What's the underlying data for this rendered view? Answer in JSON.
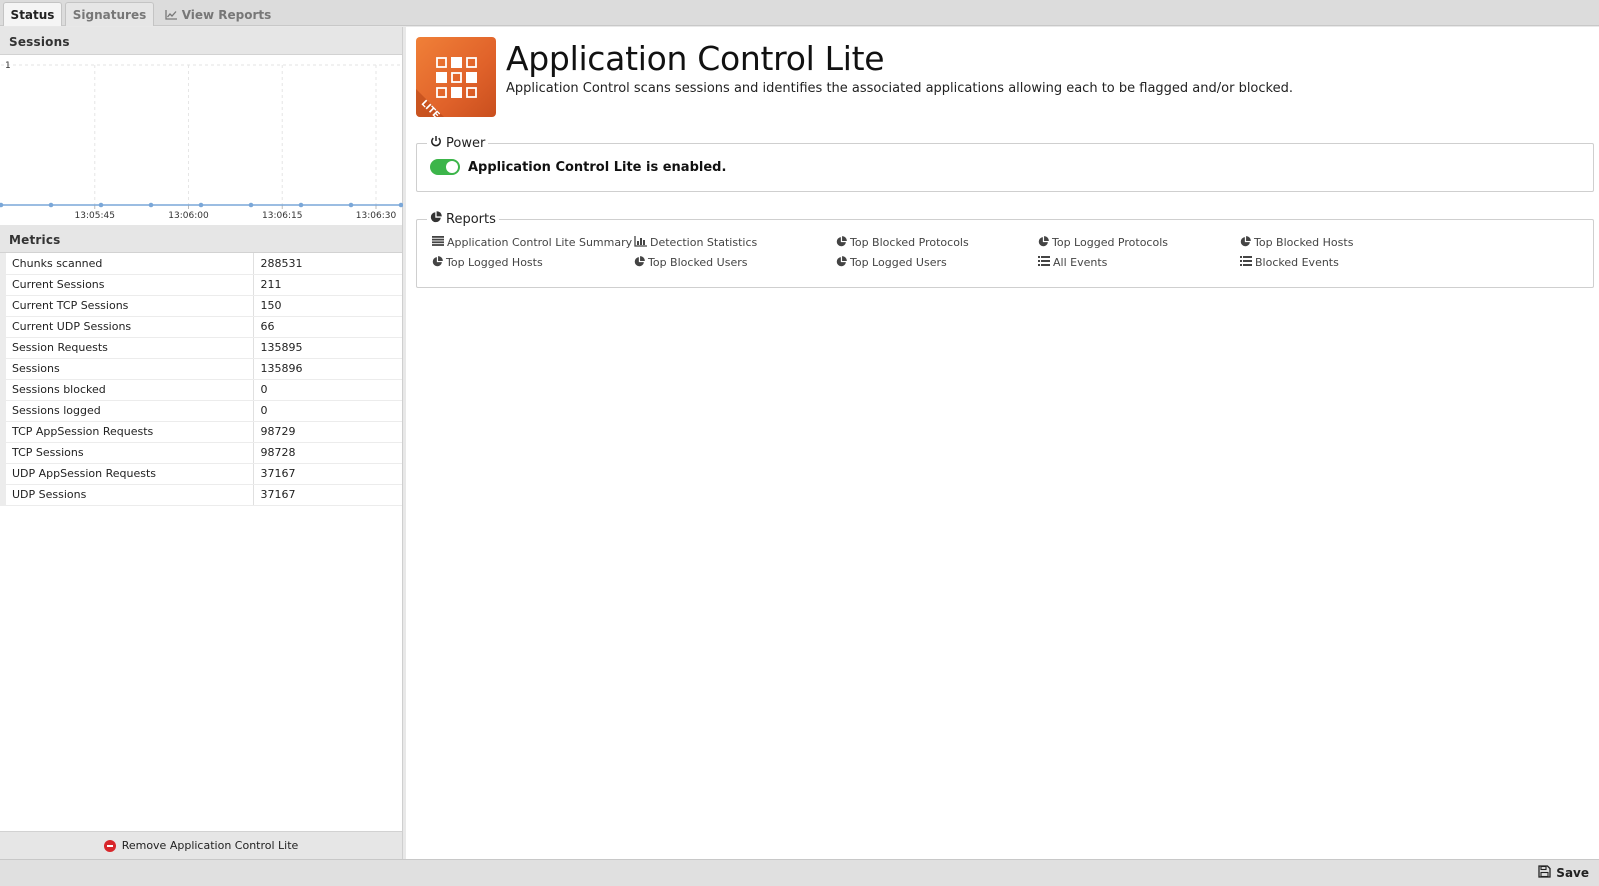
{
  "tabs": [
    {
      "label": "Status",
      "active": true
    },
    {
      "label": "Signatures",
      "active": false
    },
    {
      "label": "View Reports",
      "active": false,
      "icon": "line-chart-icon"
    }
  ],
  "sessions_panel": {
    "title": "Sessions",
    "chart_data": {
      "type": "line",
      "title": "",
      "x": [
        "13:05:30",
        "13:05:38",
        "13:05:46",
        "13:05:54",
        "13:06:02",
        "13:06:10",
        "13:06:18",
        "13:06:26",
        "13:06:34"
      ],
      "x_ticks": [
        "13:05:45",
        "13:06:00",
        "13:06:15",
        "13:06:30"
      ],
      "series": [
        {
          "values": [
            0,
            0,
            0,
            0,
            0,
            0,
            0,
            0,
            0
          ],
          "color": "#7aa7d8"
        }
      ],
      "y_ticks": [
        "1"
      ],
      "ylim": [
        0,
        1
      ],
      "grid": true
    }
  },
  "metrics_panel": {
    "title": "Metrics",
    "rows": [
      {
        "key": "Chunks scanned",
        "value": "288531"
      },
      {
        "key": "Current Sessions",
        "value": "211"
      },
      {
        "key": "Current TCP Sessions",
        "value": "150"
      },
      {
        "key": "Current UDP Sessions",
        "value": "66"
      },
      {
        "key": "Session Requests",
        "value": "135895"
      },
      {
        "key": "Sessions",
        "value": "135896"
      },
      {
        "key": "Sessions blocked",
        "value": "0"
      },
      {
        "key": "Sessions logged",
        "value": "0"
      },
      {
        "key": "TCP AppSession Requests",
        "value": "98729"
      },
      {
        "key": "TCP Sessions",
        "value": "98728"
      },
      {
        "key": "UDP AppSession Requests",
        "value": "37167"
      },
      {
        "key": "UDP Sessions",
        "value": "37167"
      }
    ]
  },
  "remove_button": {
    "label": "Remove Application Control Lite"
  },
  "app": {
    "title": "Application Control Lite",
    "description": "Application Control scans sessions and identifies the associated applications allowing each to be flagged and/or blocked.",
    "icon_badge": "LITE",
    "accent": "#e8692c"
  },
  "power": {
    "legend": "Power",
    "status": "Application Control Lite is enabled.",
    "enabled": true,
    "toggle_color": "#3cb54a"
  },
  "reports": {
    "legend": "Reports",
    "links": [
      {
        "label": "Application Control Lite Summary",
        "icon": "list-icon"
      },
      {
        "label": "Detection Statistics",
        "icon": "bar-chart-icon"
      },
      {
        "label": "Top Blocked Protocols",
        "icon": "pie-chart-icon"
      },
      {
        "label": "Top Logged Protocols",
        "icon": "pie-chart-icon"
      },
      {
        "label": "Top Blocked Hosts",
        "icon": "pie-chart-icon"
      },
      {
        "label": "Top Logged Hosts",
        "icon": "pie-chart-icon"
      },
      {
        "label": "Top Blocked Users",
        "icon": "pie-chart-icon"
      },
      {
        "label": "Top Logged Users",
        "icon": "pie-chart-icon"
      },
      {
        "label": "All Events",
        "icon": "list-ul-icon"
      },
      {
        "label": "Blocked Events",
        "icon": "list-ul-icon"
      }
    ]
  },
  "save_button": {
    "label": "Save"
  }
}
